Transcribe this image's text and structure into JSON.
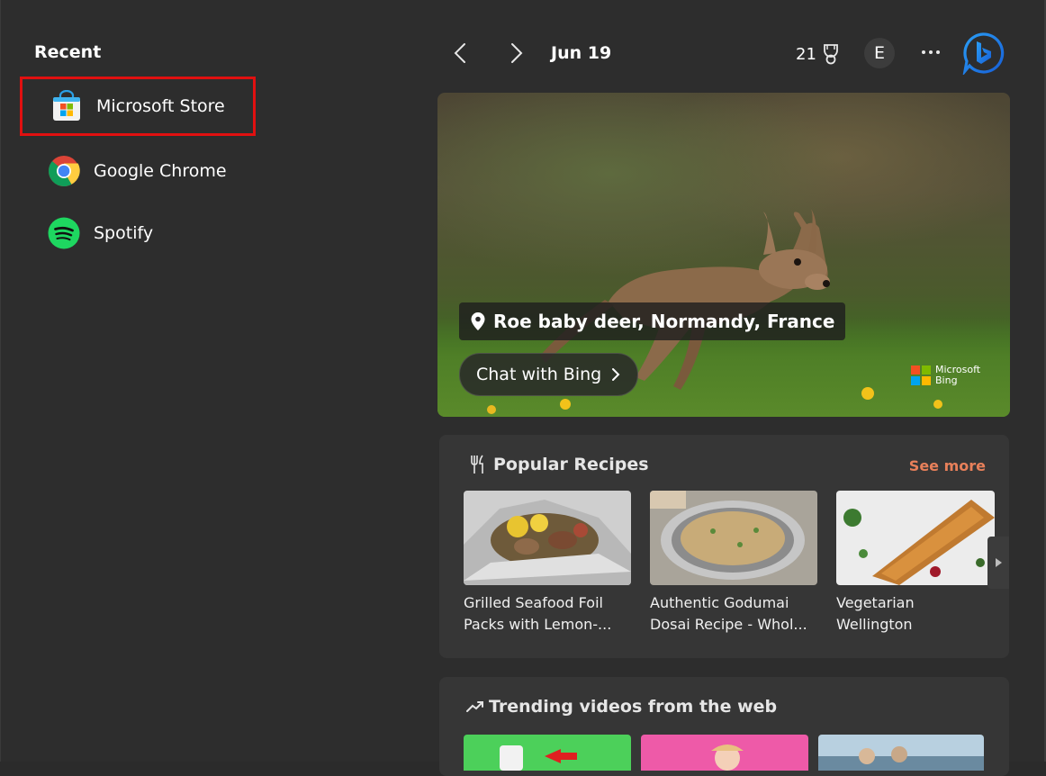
{
  "recent": {
    "title": "Recent",
    "items": [
      {
        "label": "Microsoft Store",
        "icon": "microsoft-store-icon",
        "highlighted": true
      },
      {
        "label": "Google Chrome",
        "icon": "chrome-icon"
      },
      {
        "label": "Spotify",
        "icon": "spotify-icon"
      }
    ]
  },
  "topbar": {
    "date": "Jun 19",
    "rewards_points": "21",
    "avatar_initial": "E"
  },
  "hero": {
    "location": "Roe baby deer, Normandy, France",
    "chat_label": "Chat with Bing",
    "brand_line1": "Microsoft",
    "brand_line2": "Bing"
  },
  "recipes": {
    "title": "Popular Recipes",
    "see_more": "See more",
    "items": [
      {
        "line1": "Grilled Seafood Foil",
        "line2": "Packs with Lemon-..."
      },
      {
        "line1": "Authentic Godumai",
        "line2": "Dosai Recipe - Whol..."
      },
      {
        "line1": "Vegetarian Wellington",
        "line2": ""
      }
    ]
  },
  "trending": {
    "title": "Trending videos from the web"
  },
  "colors": {
    "highlight_border": "#e01010",
    "see_more": "#e8805a",
    "background": "#2d2d2d",
    "card": "#363636"
  }
}
